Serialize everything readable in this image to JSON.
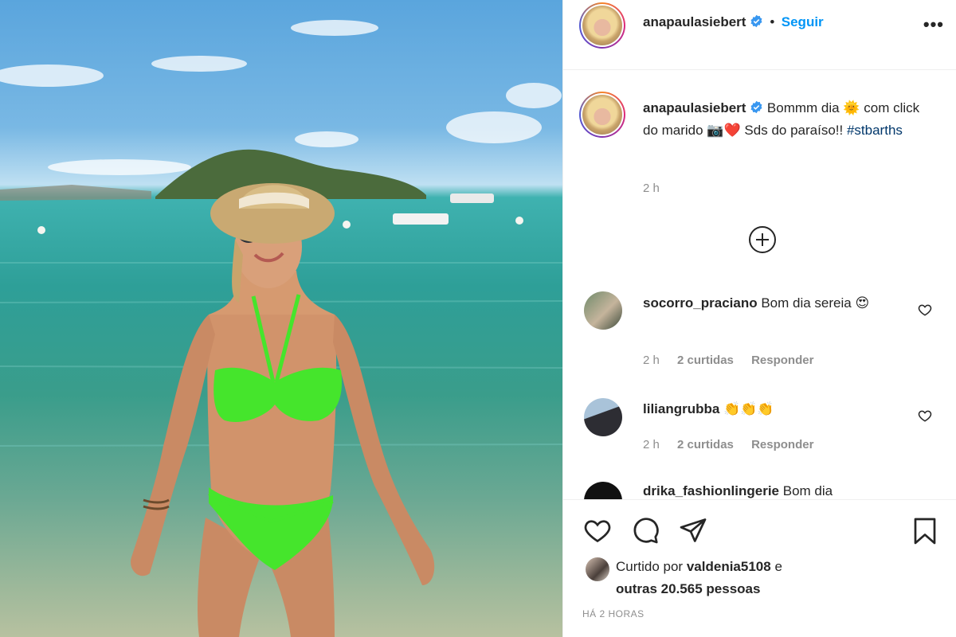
{
  "post": {
    "username": "anapaulasiebert",
    "follow_label": "Seguir",
    "separator": "•",
    "more_label": "•••"
  },
  "caption": {
    "username": "anapaulasiebert",
    "text_1": "Bommm dia",
    "emoji_1": "🌞",
    "text_2": "com click do marido",
    "emoji_2": "📷",
    "emoji_3": "❤️",
    "text_3": "Sds do paraíso!!",
    "hashtag": "#stbarths",
    "time": "2 h"
  },
  "comments": [
    {
      "username": "socorro_praciano",
      "text": "Bom dia sereia",
      "emoji": "😍",
      "time": "2 h",
      "likes": "2 curtidas",
      "reply": "Responder"
    },
    {
      "username": "liliangrubba",
      "text": "",
      "emoji": "👏👏👏",
      "time": "2 h",
      "likes": "2 curtidas",
      "reply": "Responder"
    },
    {
      "username": "drika_fashionlingerie",
      "text": "Bom dia"
    }
  ],
  "likes": {
    "prefix": "Curtido por",
    "user": "valdenia5108",
    "conj": "e",
    "others": "outras 20.565 pessoas"
  },
  "posted_ago": "HÁ 2 HORAS",
  "colors": {
    "link": "#0095f6",
    "hashtag": "#00376b",
    "muted": "#8e8e8e",
    "verified": "#3897f0"
  }
}
